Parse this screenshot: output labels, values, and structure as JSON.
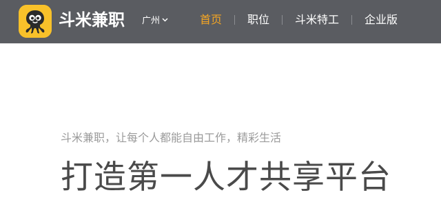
{
  "header": {
    "logo_icon": "octopus-logo-icon",
    "brand_name": "斗米兼职",
    "city": "广州",
    "city_icon": "chevron-down-icon",
    "nav": [
      {
        "label": "首页",
        "active": true
      },
      {
        "label": "职位",
        "active": false
      },
      {
        "label": "斗米特工",
        "active": false
      },
      {
        "label": "企业版",
        "active": false
      }
    ]
  },
  "hero": {
    "tagline": "斗米兼职，让每个人都能自由工作，精彩生活",
    "headline": "打造第一人才共享平台"
  },
  "colors": {
    "header_bg": "#5a5c61",
    "logo_bg": "#f8c12a",
    "nav_active": "#f5a623",
    "nav_text": "#ffffff",
    "tagline": "#9a9a9a",
    "headline": "#4a4a4a"
  }
}
